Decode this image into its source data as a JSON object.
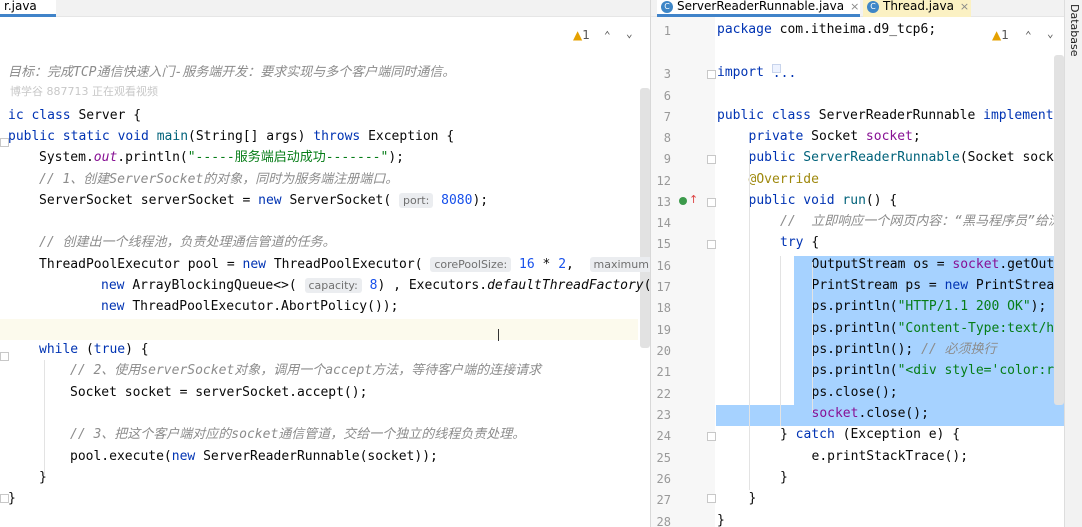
{
  "left": {
    "tab": {
      "label": "r.java"
    },
    "inspection": {
      "warnings": "1"
    },
    "watermark": "博学谷 887713 正在观看视频",
    "lines": [
      {
        "parts": [
          {
            "c": "cm",
            "t": "目标：完成TCP通信快速入门-服务端开发：要求实现与多个客户端同时通信。"
          }
        ]
      },
      {
        "parts": [
          {
            "c": "kw",
            "t": "ic class "
          },
          {
            "c": "",
            "t": "Server {"
          }
        ]
      },
      {
        "parts": [
          {
            "c": "kw",
            "t": "public static void "
          },
          {
            "c": "fn",
            "t": "main"
          },
          {
            "c": "",
            "t": "(String[] args) "
          },
          {
            "c": "kw",
            "t": "throws "
          },
          {
            "c": "",
            "t": "Exception {"
          }
        ]
      },
      {
        "parts": [
          {
            "c": "",
            "t": "System."
          },
          {
            "c": "sf",
            "t": "out"
          },
          {
            "c": "",
            "t": ".println("
          },
          {
            "c": "str",
            "t": "\"-----服务端启动成功-------\""
          },
          {
            "c": "",
            "t": ");"
          }
        ]
      },
      {
        "parts": [
          {
            "c": "cm",
            "t": "// 1、创建ServerSocket的对象，同时为服务端注册端口。"
          }
        ]
      },
      {
        "parts": [
          {
            "c": "",
            "t": "ServerSocket serverSocket = "
          },
          {
            "c": "kw",
            "t": "new "
          },
          {
            "c": "",
            "t": "ServerSocket( "
          },
          {
            "c": "hint",
            "t": "port:"
          },
          {
            "c": "num",
            "t": " 8080"
          },
          {
            "c": "",
            "t": ");"
          }
        ]
      },
      {
        "parts": [
          {
            "c": "cm",
            "t": "// 创建出一个线程池，负责处理通信管道的任务。"
          }
        ]
      },
      {
        "parts": [
          {
            "c": "",
            "t": "ThreadPoolExecutor pool = "
          },
          {
            "c": "kw",
            "t": "new "
          },
          {
            "c": "",
            "t": "ThreadPoolExecutor( "
          },
          {
            "c": "hint",
            "t": "corePoolSize:"
          },
          {
            "c": "num",
            "t": " 16 "
          },
          {
            "c": "",
            "t": "* "
          },
          {
            "c": "num",
            "t": "2"
          },
          {
            "c": "",
            "t": ",  "
          },
          {
            "c": "hint",
            "t": "maximumPo"
          }
        ]
      },
      {
        "parts": [
          {
            "c": "kw",
            "t": "new "
          },
          {
            "c": "",
            "t": "ArrayBlockingQueue<>( "
          },
          {
            "c": "hint",
            "t": "capacity:"
          },
          {
            "c": "num",
            "t": " 8"
          },
          {
            "c": "",
            "t": ") , Executors."
          },
          {
            "c": "mi",
            "t": "defaultThreadFactory"
          },
          {
            "c": "",
            "t": "(),"
          }
        ]
      },
      {
        "parts": [
          {
            "c": "kw",
            "t": "new "
          },
          {
            "c": "",
            "t": "ThreadPoolExecutor.AbortPolicy());"
          }
        ]
      },
      {
        "parts": [
          {
            "c": "kw",
            "t": "while "
          },
          {
            "c": "",
            "t": "("
          },
          {
            "c": "kw",
            "t": "true"
          },
          {
            "c": "",
            "t": ") {"
          }
        ]
      },
      {
        "parts": [
          {
            "c": "cm",
            "t": "// 2、使用serverSocket对象，调用一个accept方法，等待客户端的连接请求"
          }
        ]
      },
      {
        "parts": [
          {
            "c": "",
            "t": "Socket socket = serverSocket.accept();"
          }
        ]
      },
      {
        "parts": [
          {
            "c": "cm",
            "t": "// 3、把这个客户端对应的socket通信管道，交给一个独立的线程负责处理。"
          }
        ]
      },
      {
        "parts": [
          {
            "c": "",
            "t": "pool.execute("
          },
          {
            "c": "kw",
            "t": "new "
          },
          {
            "c": "",
            "t": "ServerReaderRunnable(socket));"
          }
        ]
      },
      {
        "parts": [
          {
            "c": "",
            "t": "}"
          }
        ]
      },
      {
        "parts": [
          {
            "c": "",
            "t": "}"
          }
        ]
      }
    ]
  },
  "right": {
    "tabs": [
      {
        "label": "ServerReaderRunnable.java",
        "icon": "C",
        "close": "×"
      },
      {
        "label": "Thread.java",
        "icon": "C",
        "close": "×"
      }
    ],
    "inspection": {
      "warnings": "1"
    },
    "sidebar_label": "Database",
    "lines": [
      {
        "n": "1",
        "parts": [
          {
            "c": "kw",
            "t": "package "
          },
          {
            "c": "",
            "t": "com.itheima.d9_tcp6;"
          }
        ]
      },
      {
        "n": "3",
        "parts": [
          {
            "c": "kw",
            "t": "import "
          },
          {
            "c": "fold",
            "t": "..."
          }
        ]
      },
      {
        "n": "6",
        "parts": []
      },
      {
        "n": "7",
        "parts": [
          {
            "c": "kw",
            "t": "public class "
          },
          {
            "c": "",
            "t": "ServerReaderRunnable "
          },
          {
            "c": "kw",
            "t": "implements"
          }
        ]
      },
      {
        "n": "8",
        "parts": [
          {
            "c": "kw",
            "t": "private "
          },
          {
            "c": "",
            "t": "Socket "
          },
          {
            "c": "fld",
            "t": "socket"
          },
          {
            "c": "",
            "t": ";"
          }
        ]
      },
      {
        "n": "9",
        "parts": [
          {
            "c": "kw",
            "t": "public "
          },
          {
            "c": "fn",
            "t": "ServerReaderRunnable"
          },
          {
            "c": "",
            "t": "(Socket socket"
          }
        ]
      },
      {
        "n": "12",
        "parts": [
          {
            "c": "ann",
            "t": "@Override"
          }
        ]
      },
      {
        "n": "13",
        "parts": [
          {
            "c": "kw",
            "t": "public void "
          },
          {
            "c": "fn",
            "t": "run"
          },
          {
            "c": "",
            "t": "() {"
          }
        ]
      },
      {
        "n": "14",
        "parts": [
          {
            "c": "cm",
            "t": "//  立即响应一个网页内容：“黑马程序员”给浏览"
          }
        ]
      },
      {
        "n": "15",
        "parts": [
          {
            "c": "kw",
            "t": "try "
          },
          {
            "c": "",
            "t": "{"
          }
        ]
      },
      {
        "n": "16",
        "parts": [
          {
            "c": "",
            "t": "OutputStream os = "
          },
          {
            "c": "fld",
            "t": "socket"
          },
          {
            "c": "",
            "t": ".getOutpu"
          }
        ]
      },
      {
        "n": "17",
        "parts": [
          {
            "c": "",
            "t": "PrintStream ps = "
          },
          {
            "c": "kw",
            "t": "new "
          },
          {
            "c": "",
            "t": "PrintStream("
          }
        ]
      },
      {
        "n": "18",
        "parts": [
          {
            "c": "",
            "t": "ps.println("
          },
          {
            "c": "str",
            "t": "\"HTTP/1.1 200 OK\""
          },
          {
            "c": "",
            "t": ");"
          }
        ]
      },
      {
        "n": "19",
        "parts": [
          {
            "c": "",
            "t": "ps.println("
          },
          {
            "c": "str",
            "t": "\"Content-Type:text/htm"
          }
        ]
      },
      {
        "n": "20",
        "parts": [
          {
            "c": "",
            "t": "ps.println(); "
          },
          {
            "c": "cm",
            "t": "// 必须换行"
          }
        ]
      },
      {
        "n": "21",
        "parts": [
          {
            "c": "",
            "t": "ps.println("
          },
          {
            "c": "str",
            "t": "\"<div style='color:red"
          }
        ]
      },
      {
        "n": "22",
        "parts": [
          {
            "c": "",
            "t": "ps.close();"
          }
        ]
      },
      {
        "n": "23",
        "parts": [
          {
            "c": "fld",
            "t": "socket"
          },
          {
            "c": "",
            "t": ".close();"
          }
        ]
      },
      {
        "n": "24",
        "parts": [
          {
            "c": "",
            "t": "} "
          },
          {
            "c": "kw",
            "t": "catch "
          },
          {
            "c": "",
            "t": "(Exception e) {"
          }
        ]
      },
      {
        "n": "25",
        "parts": [
          {
            "c": "",
            "t": "e.printStackTrace();"
          }
        ]
      },
      {
        "n": "26",
        "parts": [
          {
            "c": "",
            "t": "}"
          }
        ]
      },
      {
        "n": "27",
        "parts": [
          {
            "c": "",
            "t": "}"
          }
        ]
      },
      {
        "n": "28",
        "parts": [
          {
            "c": "",
            "t": "}"
          }
        ]
      }
    ]
  },
  "colors": {
    "accent": "#4083c9",
    "selection": "#a6d2ff",
    "warning": "#e5a100"
  }
}
